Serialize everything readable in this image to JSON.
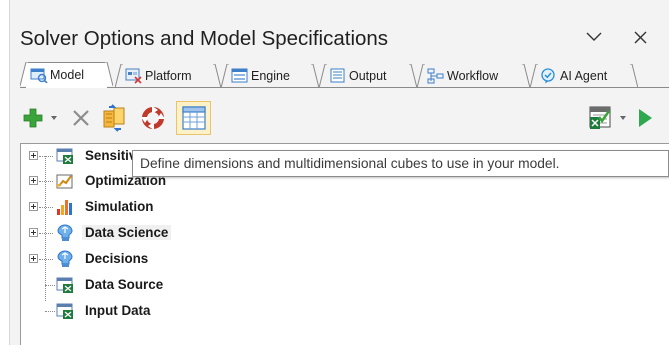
{
  "panel": {
    "title": "Solver Options and Model Specifications",
    "chevron_icon": "chevron-down-icon",
    "close_icon": "close-icon"
  },
  "tabs": [
    {
      "label": "Model",
      "icon": "model-icon",
      "active": true
    },
    {
      "label": "Platform",
      "icon": "platform-icon",
      "active": false
    },
    {
      "label": "Engine",
      "icon": "engine-icon",
      "active": false
    },
    {
      "label": "Output",
      "icon": "output-icon",
      "active": false
    },
    {
      "label": "Workflow",
      "icon": "workflow-icon",
      "active": false
    },
    {
      "label": "AI Agent",
      "icon": "ai-agent-icon",
      "active": false
    }
  ],
  "toolbar": {
    "left": [
      "add-icon",
      "dropdown-arrow-icon",
      "delete-icon",
      "refresh-model-icon",
      "cycle-icon",
      "dimensions-icon"
    ],
    "right": [
      "excel-check-icon",
      "dropdown-arrow-icon",
      "run-icon"
    ],
    "selected": "dimensions-icon"
  },
  "tree": {
    "items": [
      {
        "label": "Sensitivity",
        "icon": "sensitivity-icon",
        "expandable": true
      },
      {
        "label": "Optimization",
        "icon": "optimization-icon",
        "expandable": true
      },
      {
        "label": "Simulation",
        "icon": "simulation-icon",
        "expandable": true
      },
      {
        "label": "Data Science",
        "icon": "data-science-icon",
        "expandable": true,
        "highlighted": true
      },
      {
        "label": "Decisions",
        "icon": "decisions-icon",
        "expandable": true
      },
      {
        "label": "Data Source",
        "icon": "data-source-icon",
        "expandable": false
      },
      {
        "label": "Input Data",
        "icon": "input-data-icon",
        "expandable": false
      }
    ]
  },
  "tooltip": {
    "text": "Define dimensions and multidimensional cubes to use in your model."
  },
  "colors": {
    "background": "#f3f3f3",
    "add_green": "#3aa33a",
    "cycle_red": "#c0392b",
    "run_green": "#2fa84f",
    "selected_fill": "#fdf1c8",
    "selected_border": "#e9c46a"
  }
}
